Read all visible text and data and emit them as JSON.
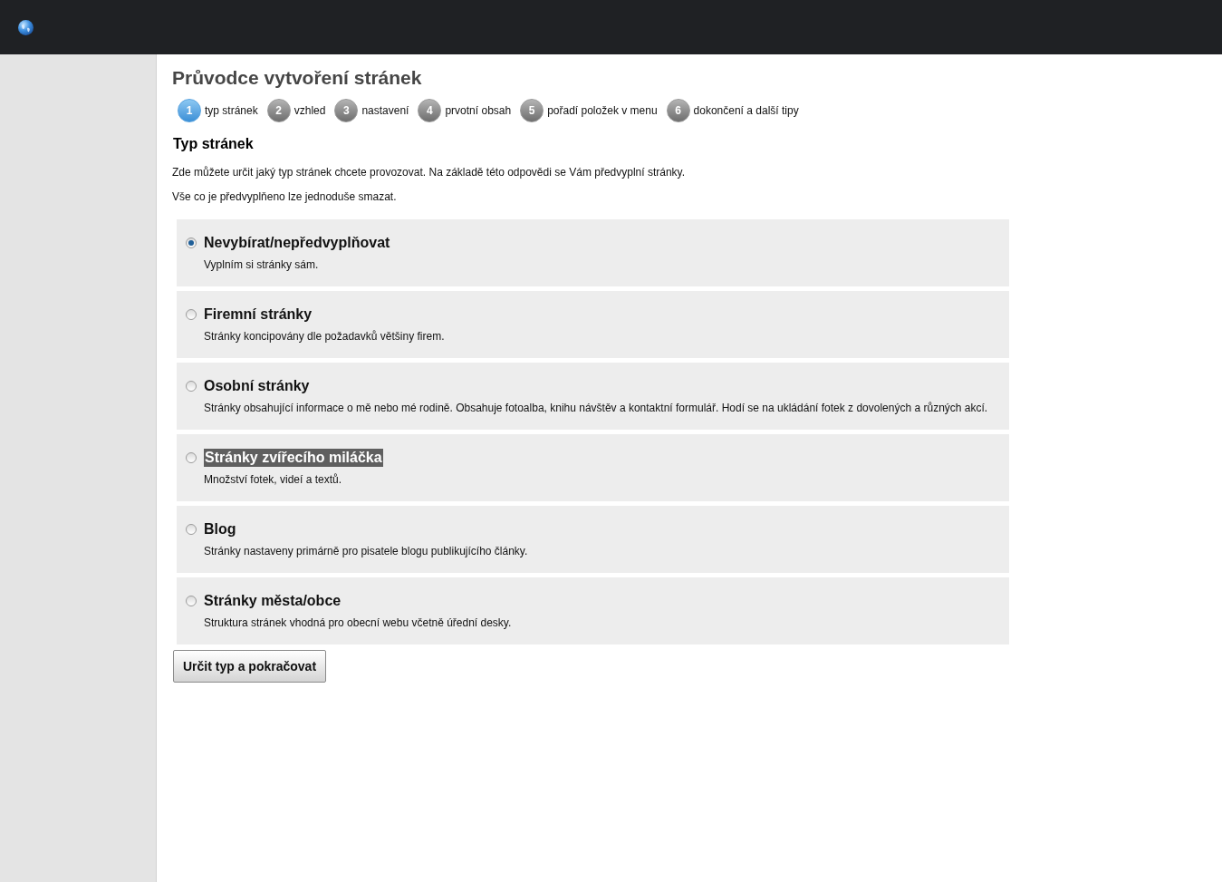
{
  "page": {
    "title": "Průvodce vytvoření stránek"
  },
  "steps": [
    {
      "number": "1",
      "label": "typ stránek",
      "selected": true
    },
    {
      "number": "2",
      "label": "vzhled",
      "selected": false
    },
    {
      "number": "3",
      "label": "nastavení",
      "selected": false
    },
    {
      "number": "4",
      "label": "prvotní obsah",
      "selected": false
    },
    {
      "number": "5",
      "label": "pořadí položek v menu",
      "selected": false
    },
    {
      "number": "6",
      "label": "dokončení a další tipy",
      "selected": false
    }
  ],
  "section": {
    "heading": "Typ stránek",
    "paragraphs": [
      "Zde můžete určit jaký typ stránek chcete provozovat. Na základě této odpovědi se Vám předvyplní stránky.",
      "Vše co je předvyplňeno lze jednoduše smazat."
    ]
  },
  "options": [
    {
      "title": "Nevybírat/nepředvyplňovat",
      "description": "Vyplním si stránky sám.",
      "selected": true,
      "highlighted": false
    },
    {
      "title": "Firemní stránky",
      "description": "Stránky koncipovány dle požadavků většiny firem.",
      "selected": false,
      "highlighted": false
    },
    {
      "title": "Osobní stránky",
      "description": "Stránky obsahující informace o mě nebo mé rodině. Obsahuje fotoalba, knihu návštěv a kontaktní formulář. Hodí se na ukládání fotek z dovolených a různých akcí.",
      "selected": false,
      "highlighted": false
    },
    {
      "title": "Stránky zvířecího miláčka",
      "description": "Množství fotek, videí a textů.",
      "selected": false,
      "highlighted": true
    },
    {
      "title": "Blog",
      "description": "Stránky nastaveny primárně pro pisatele blogu publikujícího články.",
      "selected": false,
      "highlighted": false
    },
    {
      "title": "Stránky města/obce",
      "description": "Struktura stránek vhodná pro obecní webu včetně úřední desky.",
      "selected": false,
      "highlighted": false
    }
  ],
  "submit_button": {
    "label": "Určit typ a pokračovat"
  }
}
